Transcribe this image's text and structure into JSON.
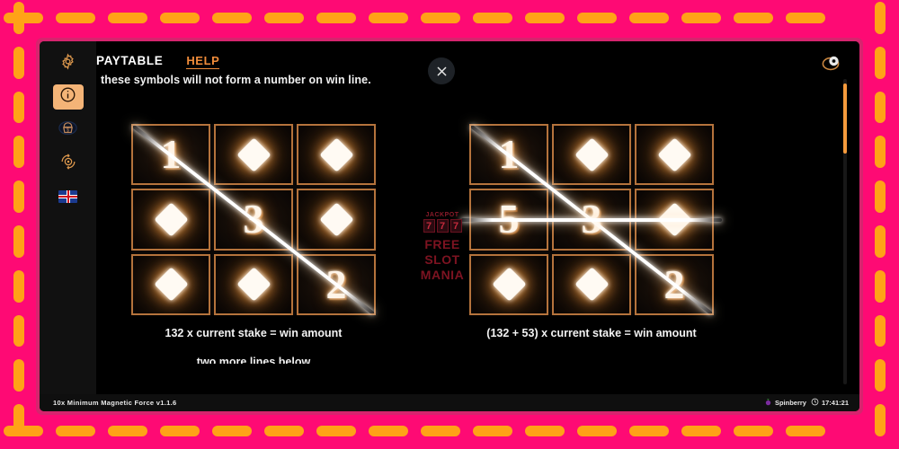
{
  "theme": {
    "frame_pink": "#fe0a74",
    "frame_orange": "#ffa217",
    "accent_orange": "#f08c3a",
    "screen_black": "#000000",
    "sidebar_dark": "#111111",
    "active_sidebar": "#f4b477",
    "watermark_red": "#7d1321"
  },
  "sidebar": {
    "items": [
      {
        "icon": "gear-icon",
        "name": "settings",
        "active": false
      },
      {
        "icon": "info-icon",
        "name": "paytable",
        "active": true
      },
      {
        "icon": "money-lock-icon",
        "name": "bet-limits",
        "active": false
      },
      {
        "icon": "autoplay-icon",
        "name": "autoplay",
        "active": false
      },
      {
        "icon": "uk-flag-icon",
        "name": "language",
        "active": false
      }
    ]
  },
  "header": {
    "title": "PAYTABLE",
    "help_label": "HELP",
    "close_icon": "close-icon",
    "eye_icon": "eye-icon"
  },
  "main": {
    "subtitle": "these symbols will not form a number on win line.",
    "examples": [
      {
        "name": "single-line-example",
        "caption": "132 x current stake = win amount",
        "winlines": [
          "diagonal"
        ],
        "cells": [
          [
            "1",
            "diamond",
            "diamond"
          ],
          [
            "diamond",
            "3",
            "diamond"
          ],
          [
            "diamond",
            "diamond",
            "2"
          ]
        ]
      },
      {
        "name": "double-line-example",
        "caption": "(132 + 53) x current stake = win amount",
        "winlines": [
          "diagonal",
          "horizontal"
        ],
        "cells": [
          [
            "1",
            "diamond",
            "diamond"
          ],
          [
            "5",
            "3",
            "diamond"
          ],
          [
            "diamond",
            "diamond",
            "2"
          ]
        ]
      }
    ],
    "cut_off_text": "two more lines below"
  },
  "watermark": {
    "jackpot_label": "JACKPOT",
    "reels": [
      "7",
      "7",
      "7"
    ],
    "lines": [
      "FREE",
      "SLOT",
      "MANIA"
    ]
  },
  "scrollbar": {
    "position_percent": 2
  },
  "footer": {
    "game_title": "10x Minimum Magnetic Force v1.1.6",
    "brand": "Spinberry",
    "brand_icon": "berry-icon",
    "clock_icon": "clock-icon",
    "time": "17:41:21"
  }
}
